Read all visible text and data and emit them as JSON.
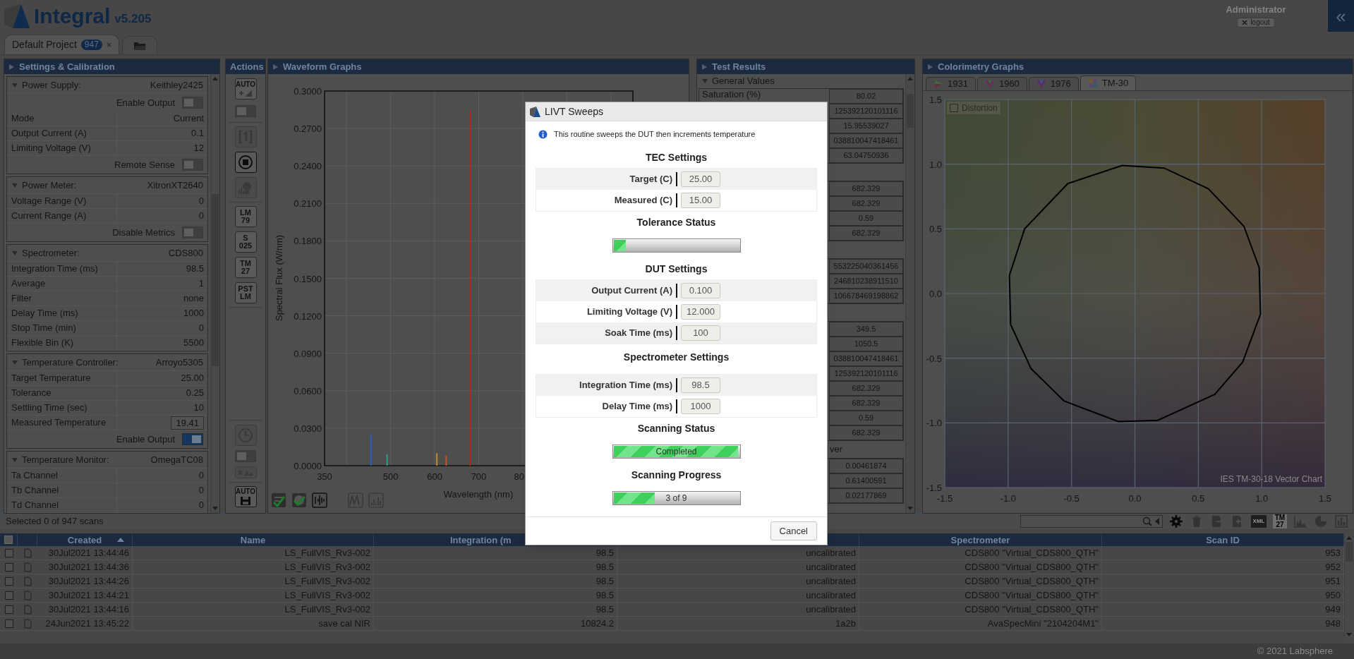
{
  "app": {
    "title": "Integral",
    "version": "v5.205",
    "user": "Administrator",
    "logout": "logout",
    "collapse": "«"
  },
  "project_tabs": [
    {
      "kind": "project",
      "label": "Default Project",
      "badge": "947",
      "close": "×",
      "selected": true
    },
    {
      "kind": "folder",
      "selected": false
    }
  ],
  "settings": {
    "title": "Settings & Calibration",
    "sections": [
      {
        "title": "Power Supply:",
        "device": "Keithley2425",
        "rows": [
          {
            "kind": "toggle",
            "label": "Enable Output",
            "on": false
          },
          {
            "kind": "value",
            "label": "Mode",
            "value": "Current"
          },
          {
            "kind": "value",
            "label": "Output Current (A)",
            "value": "0.1"
          },
          {
            "kind": "value",
            "label": "Limiting Voltage (V)",
            "value": "12"
          },
          {
            "kind": "toggle",
            "label": "Remote Sense",
            "on": false
          }
        ]
      },
      {
        "title": "Power Meter:",
        "device": "XitronXT2640",
        "rows": [
          {
            "kind": "value",
            "label": "Voltage Range (V)",
            "value": "0"
          },
          {
            "kind": "value",
            "label": "Current Range (A)",
            "value": "0"
          },
          {
            "kind": "toggle",
            "label": "Disable Metrics",
            "on": false
          }
        ]
      },
      {
        "title": "Spectrometer:",
        "device": "CDS800",
        "rows": [
          {
            "kind": "value",
            "label": "Integration Time (ms)",
            "value": "98.5"
          },
          {
            "kind": "value",
            "label": "Average",
            "value": "1"
          },
          {
            "kind": "value",
            "label": "Filter",
            "value": "none"
          },
          {
            "kind": "value",
            "label": "Delay Time (ms)",
            "value": "1000"
          },
          {
            "kind": "value",
            "label": "Stop Time (min)",
            "value": "0"
          },
          {
            "kind": "value",
            "label": "Flexible Bin (K)",
            "value": "5500"
          }
        ]
      },
      {
        "title": "Temperature Controller:",
        "device": "Arroyo5305",
        "rows": [
          {
            "kind": "value",
            "label": "Target Temperature",
            "value": "25.00"
          },
          {
            "kind": "value",
            "label": "Tolerance",
            "value": "0.25"
          },
          {
            "kind": "value",
            "label": "Settling Time (sec)",
            "value": "10"
          },
          {
            "kind": "readout",
            "label": "Measured Temperature",
            "value": "19.41"
          },
          {
            "kind": "toggle",
            "label": "Enable Output",
            "on": true
          }
        ]
      },
      {
        "title": "Temperature Monitor:",
        "device": "OmegaTC08",
        "rows": [
          {
            "kind": "value",
            "label": "Ta Channel",
            "value": "0"
          },
          {
            "kind": "value",
            "label": "Tb Channel",
            "value": "0"
          },
          {
            "kind": "value",
            "label": "Td Channel",
            "value": "0"
          }
        ]
      }
    ]
  },
  "actions": {
    "title": "Actions",
    "top": [
      {
        "kind": "auto",
        "label": "AUTO"
      },
      {
        "kind": "switch",
        "on": false
      },
      {
        "kind": "single"
      },
      {
        "kind": "stop"
      },
      {
        "kind": "lamp"
      },
      {
        "kind": "standard",
        "label": "LM\n79"
      },
      {
        "kind": "standard",
        "label": "S\n025"
      },
      {
        "kind": "standard",
        "label": "TM\n27"
      },
      {
        "kind": "standard",
        "label": "PST\nLM"
      }
    ],
    "bottom": [
      {
        "kind": "clock"
      },
      {
        "kind": "switch",
        "on": false
      },
      {
        "kind": "scale"
      },
      {
        "kind": "auto_save",
        "label": "AUTO"
      }
    ]
  },
  "waveform": {
    "title": "Waveform Graphs",
    "chart_data": {
      "type": "bar",
      "xlabel": "Wavelength (nm)",
      "ylabel": "Spectral Flux (W/nm)",
      "x": [
        455,
        492,
        605,
        626,
        680
      ],
      "series": [
        {
          "values": [
            0.025,
            0.009,
            0.01,
            0.008,
            0.284
          ]
        }
      ],
      "xlim": [
        350,
        1050
      ],
      "ylim": [
        0,
        0.3
      ],
      "grid": true,
      "xticks": [
        350,
        500,
        600,
        700
      ],
      "yticks": [
        {
          "value": 0,
          "label": "0.0000"
        },
        {
          "value": 0.03,
          "label": "0.0300"
        },
        {
          "value": 0.06,
          "label": "0.0600"
        },
        {
          "value": 0.09,
          "label": "0.0900"
        },
        {
          "value": 0.12,
          "label": "0.1200"
        },
        {
          "value": 0.15,
          "label": "0.1500"
        },
        {
          "value": 0.18,
          "label": "0.1800"
        },
        {
          "value": 0.21,
          "label": "0.2100"
        },
        {
          "value": 0.24,
          "label": "0.2400"
        },
        {
          "value": 0.27,
          "label": "0.2700"
        },
        {
          "value": 0.3,
          "label": "0.3000"
        }
      ]
    },
    "cut_tick_label": "80",
    "tools": [
      {
        "kind": "select_check",
        "disabled": false
      },
      {
        "kind": "round_check",
        "disabled": false
      },
      {
        "kind": "bars",
        "disabled": false
      },
      {
        "kind": "peaks",
        "disabled": true
      },
      {
        "kind": "histogram",
        "disabled": true
      }
    ]
  },
  "test_results": {
    "title": "Test Results",
    "groups": [
      {
        "title": "General Values",
        "rows": [
          {
            "label": "Saturation (%)",
            "value": "80.02"
          },
          {
            "value": "125392120101116"
          },
          {
            "value": "15.95539027"
          },
          {
            "value": "038810047418461"
          },
          {
            "value": "63.04750936"
          }
        ]
      },
      {
        "rows": [
          {
            "value": "682.329"
          },
          {
            "value": "682.329"
          },
          {
            "value": "0.59"
          },
          {
            "value": "682.329"
          }
        ]
      },
      {
        "rows": [
          {
            "value": "553225040361456"
          },
          {
            "value": "246810238911510"
          },
          {
            "value": "106678469198862"
          }
        ]
      },
      {
        "rows": [
          {
            "value": "349.5"
          },
          {
            "value": "1050.5"
          },
          {
            "value": "038810047418461"
          },
          {
            "value": "125392120101116"
          },
          {
            "value": "682.329"
          },
          {
            "value": "682.329"
          },
          {
            "value": "0.59"
          },
          {
            "value": "682.329"
          }
        ]
      },
      {
        "title": "ver",
        "rows": [
          {
            "value": "0.00461874"
          },
          {
            "value": "0.61400591"
          },
          {
            "value": "0.02177869"
          }
        ]
      }
    ]
  },
  "colorimetry": {
    "title": "Colorimetry Graphs",
    "tabs": [
      {
        "label": "1931",
        "selected": false
      },
      {
        "label": "1960",
        "selected": false
      },
      {
        "label": "1976",
        "selected": false
      },
      {
        "label": "TM-30",
        "selected": true
      }
    ],
    "distortion": {
      "label": "Distortion",
      "checked": false
    },
    "caption": "IES TM-30-18 Vector Chart",
    "vector_chart": {
      "grid": true,
      "x_axis_labels": [
        "-1.5",
        "-1.0",
        "-0.5",
        "0.0",
        "0.5",
        "1.0",
        "1.5"
      ],
      "y_axis_labels": [
        "1.5",
        "1.0",
        "0.5",
        "0.0",
        "-0.5",
        "-1.0",
        "-1.5"
      ]
    }
  },
  "scan_bar": {
    "summary": "Selected 0 of 947 scans",
    "tools": [
      {
        "kind": "settings"
      },
      {
        "kind": "delete"
      },
      {
        "kind": "export"
      },
      {
        "kind": "import"
      },
      {
        "kind": "xml",
        "label": "XML"
      },
      {
        "kind": "tm",
        "label": "TM\n27"
      },
      {
        "kind": "spectrum"
      },
      {
        "kind": "pie"
      },
      {
        "kind": "bar_chart"
      }
    ]
  },
  "table": {
    "all_checked": false,
    "columns": [
      {
        "kind": "text",
        "label": "Created",
        "sorted": true
      },
      {
        "kind": "text",
        "label": "Name",
        "sorted": false
      },
      {
        "kind": "text",
        "label": "Integration (m",
        "sorted": false
      },
      {
        "kind": "blank",
        "sorted": false
      },
      {
        "kind": "text",
        "label": "Spectrometer",
        "sorted": false
      },
      {
        "kind": "text",
        "label": "Scan ID",
        "sorted": false
      }
    ],
    "rows": [
      {
        "checked": false,
        "cells": [
          "30Jul2021 13:44:46",
          "LS_FullVIS_Rv3-002",
          "98.5",
          "uncalibrated",
          "CDS800 \"Virtual_CDS800_QTH\"",
          "953"
        ]
      },
      {
        "checked": false,
        "cells": [
          "30Jul2021 13:44:36",
          "LS_FullVIS_Rv3-002",
          "98.5",
          "uncalibrated",
          "CDS800 \"Virtual_CDS800_QTH\"",
          "952"
        ]
      },
      {
        "checked": false,
        "cells": [
          "30Jul2021 13:44:26",
          "LS_FullVIS_Rv3-002",
          "98.5",
          "uncalibrated",
          "CDS800 \"Virtual_CDS800_QTH\"",
          "951"
        ]
      },
      {
        "checked": false,
        "cells": [
          "30Jul2021 13:44:21",
          "LS_FullVIS_Rv3-002",
          "98.5",
          "uncalibrated",
          "CDS800 \"Virtual_CDS800_QTH\"",
          "950"
        ]
      },
      {
        "checked": false,
        "cells": [
          "30Jul2021 13:44:16",
          "LS_FullVIS_Rv3-002",
          "98.5",
          "uncalibrated",
          "CDS800 \"Virtual_CDS800_QTH\"",
          "949"
        ]
      },
      {
        "checked": false,
        "cells": [
          "24Jun2021 13:45:22",
          "save cal NIR",
          "10824.2",
          "1a2b",
          "AvaSpecMini \"2104204M1\"",
          "948"
        ]
      }
    ]
  },
  "footer": {
    "copyright": "© 2021 Labsphere"
  },
  "dialog": {
    "title": "LIVT Sweeps",
    "info": "This routine sweeps the DUT then increments temperature",
    "sections": [
      {
        "kind": "fields",
        "title": "TEC Settings",
        "fields": [
          {
            "label": "Target (C)",
            "value": "25.00"
          },
          {
            "label": "Measured (C)",
            "value": "15.00"
          }
        ]
      },
      {
        "kind": "progress",
        "title": "Tolerance Status",
        "level": 0.1
      },
      {
        "kind": "fields",
        "title": "DUT Settings",
        "fields": [
          {
            "label": "Output Current (A)",
            "value": "0.100"
          },
          {
            "label": "Limiting Voltage (V)",
            "value": "12.000"
          },
          {
            "label": "Soak Time (ms)",
            "value": "100"
          }
        ]
      },
      {
        "kind": "fields",
        "title": "Spectrometer Settings",
        "fields": [
          {
            "label": "Integration Time (ms)",
            "value": "98.5"
          },
          {
            "label": "Delay Time (ms)",
            "value": "1000"
          }
        ]
      },
      {
        "kind": "progress",
        "title": "Scanning Status",
        "level": 1,
        "text": "Completed"
      },
      {
        "kind": "progress",
        "title": "Scanning Progress",
        "level": 0.333,
        "text": "3 of 9"
      }
    ],
    "buttons": [
      {
        "label": "Cancel"
      }
    ]
  }
}
